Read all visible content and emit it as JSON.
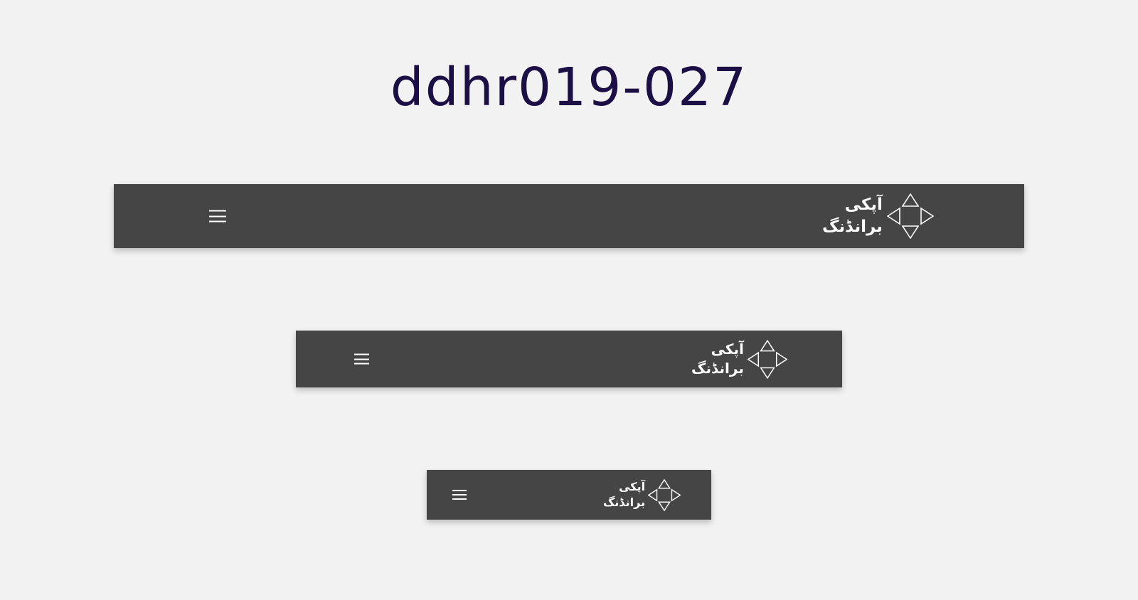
{
  "page": {
    "title": "ddhr019-027"
  },
  "navbars": [
    {
      "size": "large",
      "menu_icon": "hamburger-icon",
      "logo_line1": "آپکی",
      "logo_line2": "برانڈنگ",
      "logo_icon": "four-triangles-icon"
    },
    {
      "size": "medium",
      "menu_icon": "hamburger-icon",
      "logo_line1": "آپکی",
      "logo_line2": "برانڈنگ",
      "logo_icon": "four-triangles-icon"
    },
    {
      "size": "small",
      "menu_icon": "hamburger-icon",
      "logo_line1": "آپکی",
      "logo_line2": "برانڈنگ",
      "logo_icon": "four-triangles-icon"
    }
  ],
  "colors": {
    "background": "#f2f2f2",
    "navbar": "#454545",
    "title": "#1c0f46",
    "foreground": "#ffffff"
  }
}
